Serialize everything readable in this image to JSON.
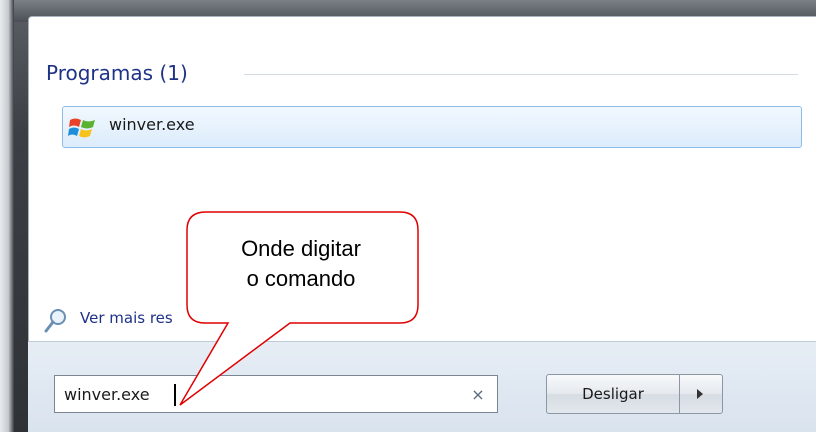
{
  "start_menu": {
    "section_title": "Programas (1)",
    "results": [
      {
        "label": "winver.exe",
        "icon": "windows-program-icon"
      }
    ],
    "see_more_label": "Ver mais res",
    "see_more_icon": "magnifier-icon",
    "search": {
      "value": "winver.exe",
      "clear_icon": "×"
    },
    "shutdown_label": "Desligar",
    "shutdown_arrow_icon": "triangle-right-icon"
  },
  "annotation": {
    "line1": "Onde digitar",
    "line2": "o comando"
  },
  "colors": {
    "frame": "#3c4045",
    "section_title": "#1e3287",
    "selection": "#dcecfb",
    "callout_stroke": "#e00000"
  }
}
